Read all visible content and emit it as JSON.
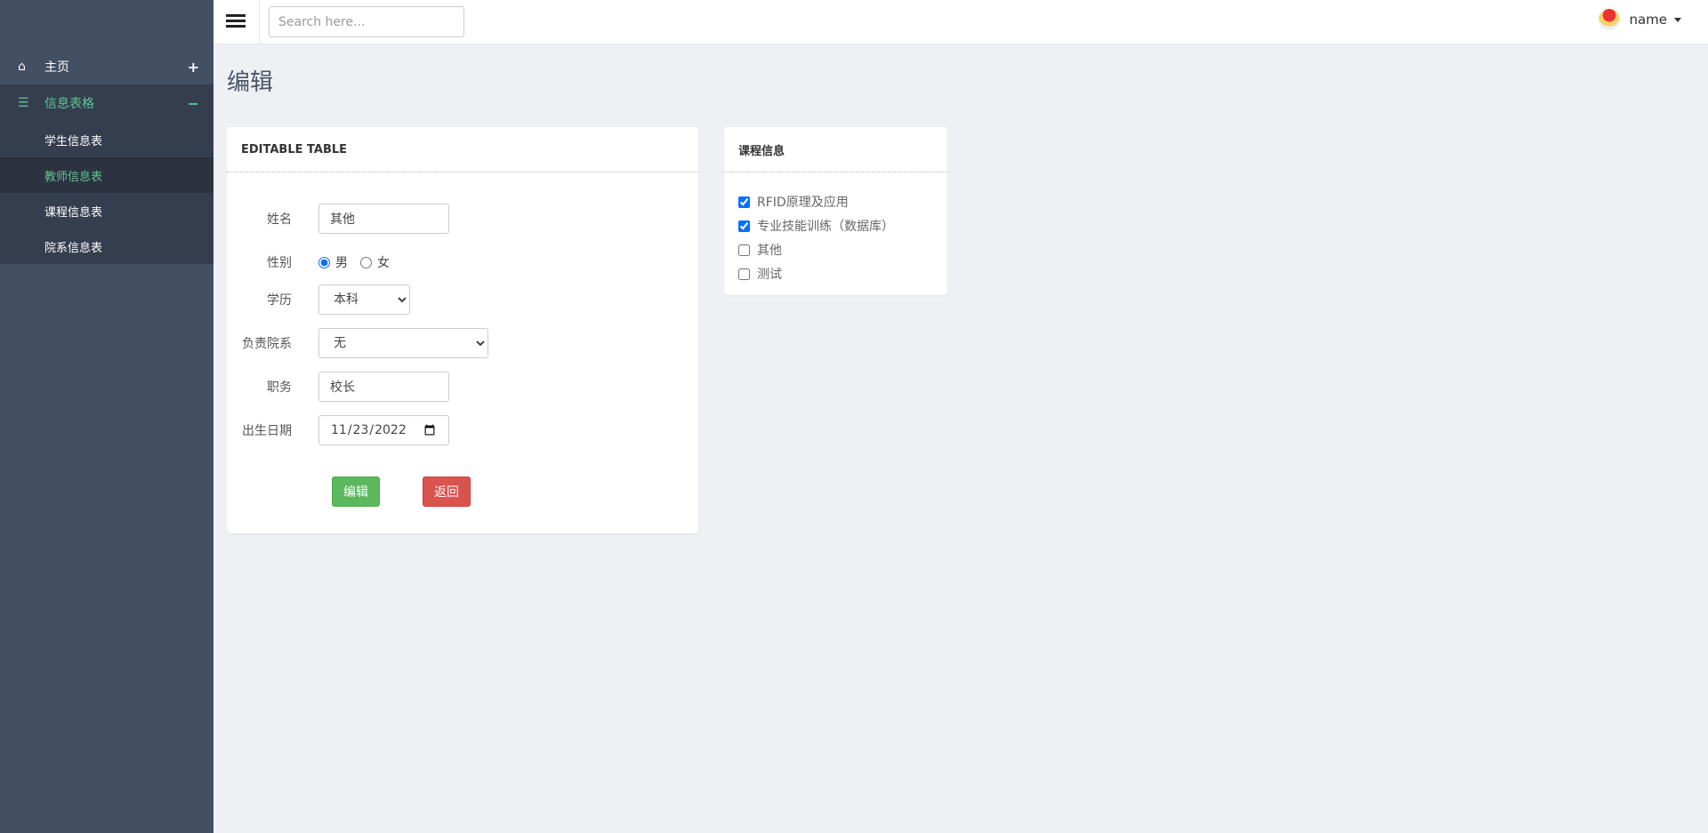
{
  "sidebar": {
    "items": [
      {
        "label": "主页",
        "icon": "home-icon",
        "toggle": "+"
      },
      {
        "label": "信息表格",
        "icon": "table-icon",
        "toggle": "−",
        "open": true,
        "children": [
          {
            "label": "学生信息表"
          },
          {
            "label": "教师信息表",
            "active": true
          },
          {
            "label": "课程信息表"
          },
          {
            "label": "院系信息表"
          }
        ]
      }
    ]
  },
  "header": {
    "search_placeholder": "Search here...",
    "user_name": "name"
  },
  "page": {
    "title": "编辑"
  },
  "form": {
    "card_title": "EDITABLE TABLE",
    "name": {
      "label": "姓名",
      "value": "其他"
    },
    "gender": {
      "label": "性别",
      "options": [
        "男",
        "女"
      ],
      "selected": "男"
    },
    "education": {
      "label": "学历",
      "value": "本科"
    },
    "department": {
      "label": "负责院系",
      "value": "无"
    },
    "position": {
      "label": "职务",
      "value": "校长"
    },
    "birthdate": {
      "label": "出生日期",
      "value": "2022-11-23"
    },
    "submit_label": "编辑",
    "back_label": "返回"
  },
  "courses": {
    "title": "课程信息",
    "items": [
      {
        "label": "RFID原理及应用",
        "checked": true
      },
      {
        "label": "专业技能训练（数据库）",
        "checked": true
      },
      {
        "label": "其他",
        "checked": false
      },
      {
        "label": "测试",
        "checked": false
      }
    ]
  },
  "colors": {
    "accent": "#5dc592",
    "sidebar": "#434f63",
    "success": "#5cb85c",
    "danger": "#d9534f"
  }
}
